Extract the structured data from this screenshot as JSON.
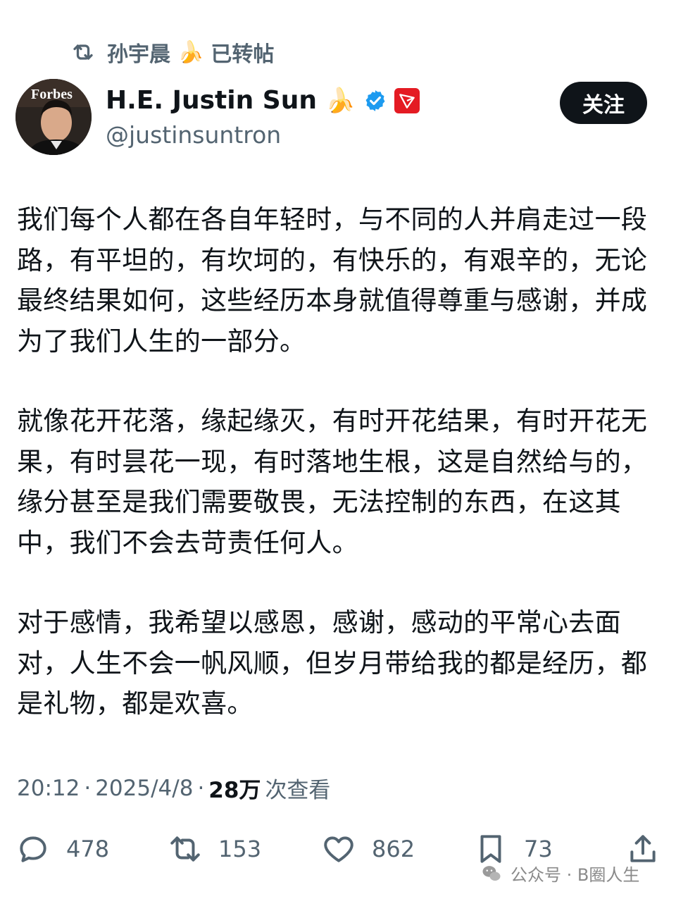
{
  "repost": {
    "name": "孙宇晨",
    "emoji": "🍌",
    "suffix": "已转帖"
  },
  "author": {
    "avatar_text": "Forbes",
    "display_name": "H.E. Justin Sun",
    "name_emoji": "🍌",
    "handle": "@justinsuntron"
  },
  "follow_label": "关注",
  "tweet": {
    "paragraphs": [
      "我们每个人都在各自年轻时，与不同的人并肩走过一段路，有平坦的，有坎坷的，有快乐的，有艰辛的，无论最终结果如何，这些经历本身就值得尊重与感谢，并成为了我们人生的一部分。",
      "就像花开花落，缘起缘灭，有时开花结果，有时开花无果，有时昙花一现，有时落地生根，这是自然给与的，缘分甚至是我们需要敬畏，无法控制的东西，在这其中，我们不会去苛责任何人。",
      "对于感情，我希望以感恩，感谢，感动的平常心去面对，人生不会一帆风顺，但岁月带给我的都是经历，都是礼物，都是欢喜。"
    ]
  },
  "meta": {
    "time": "20:12",
    "separator": "·",
    "date": "2025/4/8",
    "views": "28万",
    "views_label": "次查看"
  },
  "actions": {
    "replies": "478",
    "reposts": "153",
    "likes": "862",
    "bookmarks": "73"
  },
  "watermark": "公众号 · B圈人生",
  "colors": {
    "text_primary": "#0f1419",
    "text_secondary": "#536471",
    "verified_blue": "#1d9bf0",
    "tron_red": "#e41b23",
    "button_bg": "#0f1419"
  },
  "icons": [
    "repost-icon",
    "verified-icon",
    "tron-icon",
    "reply-icon",
    "like-icon",
    "bookmark-icon",
    "share-icon",
    "wechat-icon"
  ]
}
